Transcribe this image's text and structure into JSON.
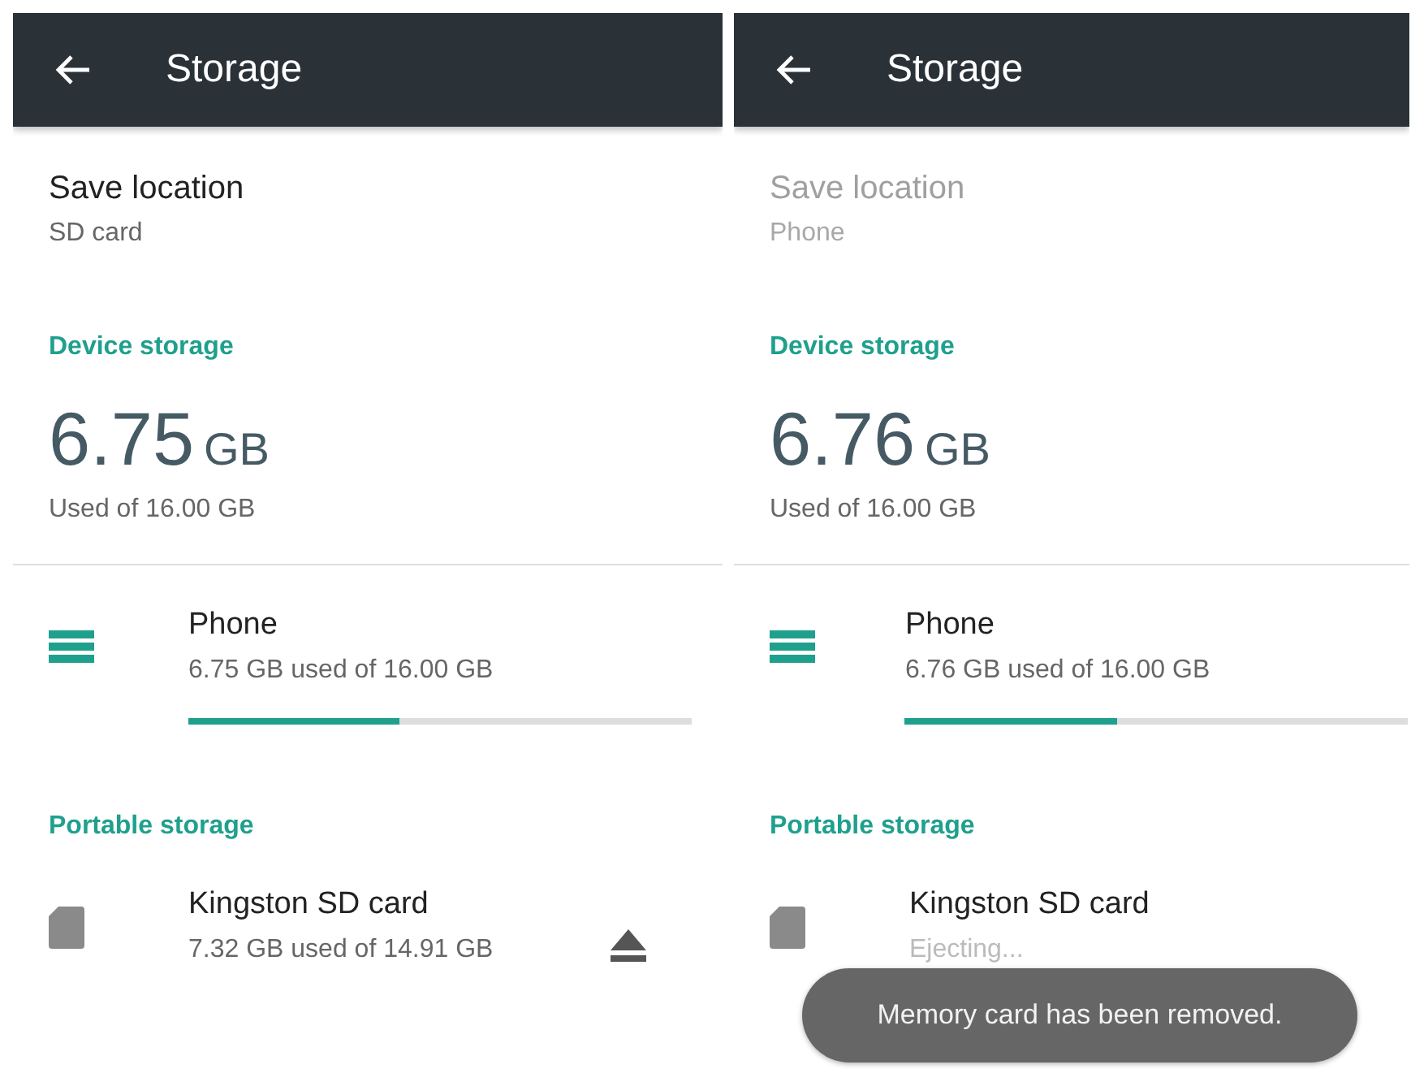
{
  "screens": [
    {
      "title": "Storage",
      "save_location": {
        "label": "Save location",
        "value": "SD card",
        "disabled": false
      },
      "device_storage": {
        "heading": "Device storage",
        "used_number": "6.75",
        "used_unit": "GB",
        "caption": "Used of 16.00 GB"
      },
      "phone": {
        "name": "Phone",
        "summary": "6.75 GB used of 16.00 GB",
        "level": 0.42
      },
      "portable": {
        "heading": "Portable storage",
        "card": {
          "name": "Kingston SD card",
          "summary": "7.32 GB used of 14.91 GB",
          "ejecting": false
        }
      }
    },
    {
      "title": "Storage",
      "save_location": {
        "label": "Save location",
        "value": "Phone",
        "disabled": true
      },
      "device_storage": {
        "heading": "Device storage",
        "used_number": "6.76",
        "used_unit": "GB",
        "caption": "Used of 16.00 GB"
      },
      "phone": {
        "name": "Phone",
        "summary": "6.76 GB used of 16.00 GB",
        "level": 0.42
      },
      "portable": {
        "heading": "Portable storage",
        "card": {
          "name": "Kingston SD card",
          "summary": "Ejecting...",
          "ejecting": true
        }
      },
      "toast": "Memory card has been removed."
    }
  ]
}
